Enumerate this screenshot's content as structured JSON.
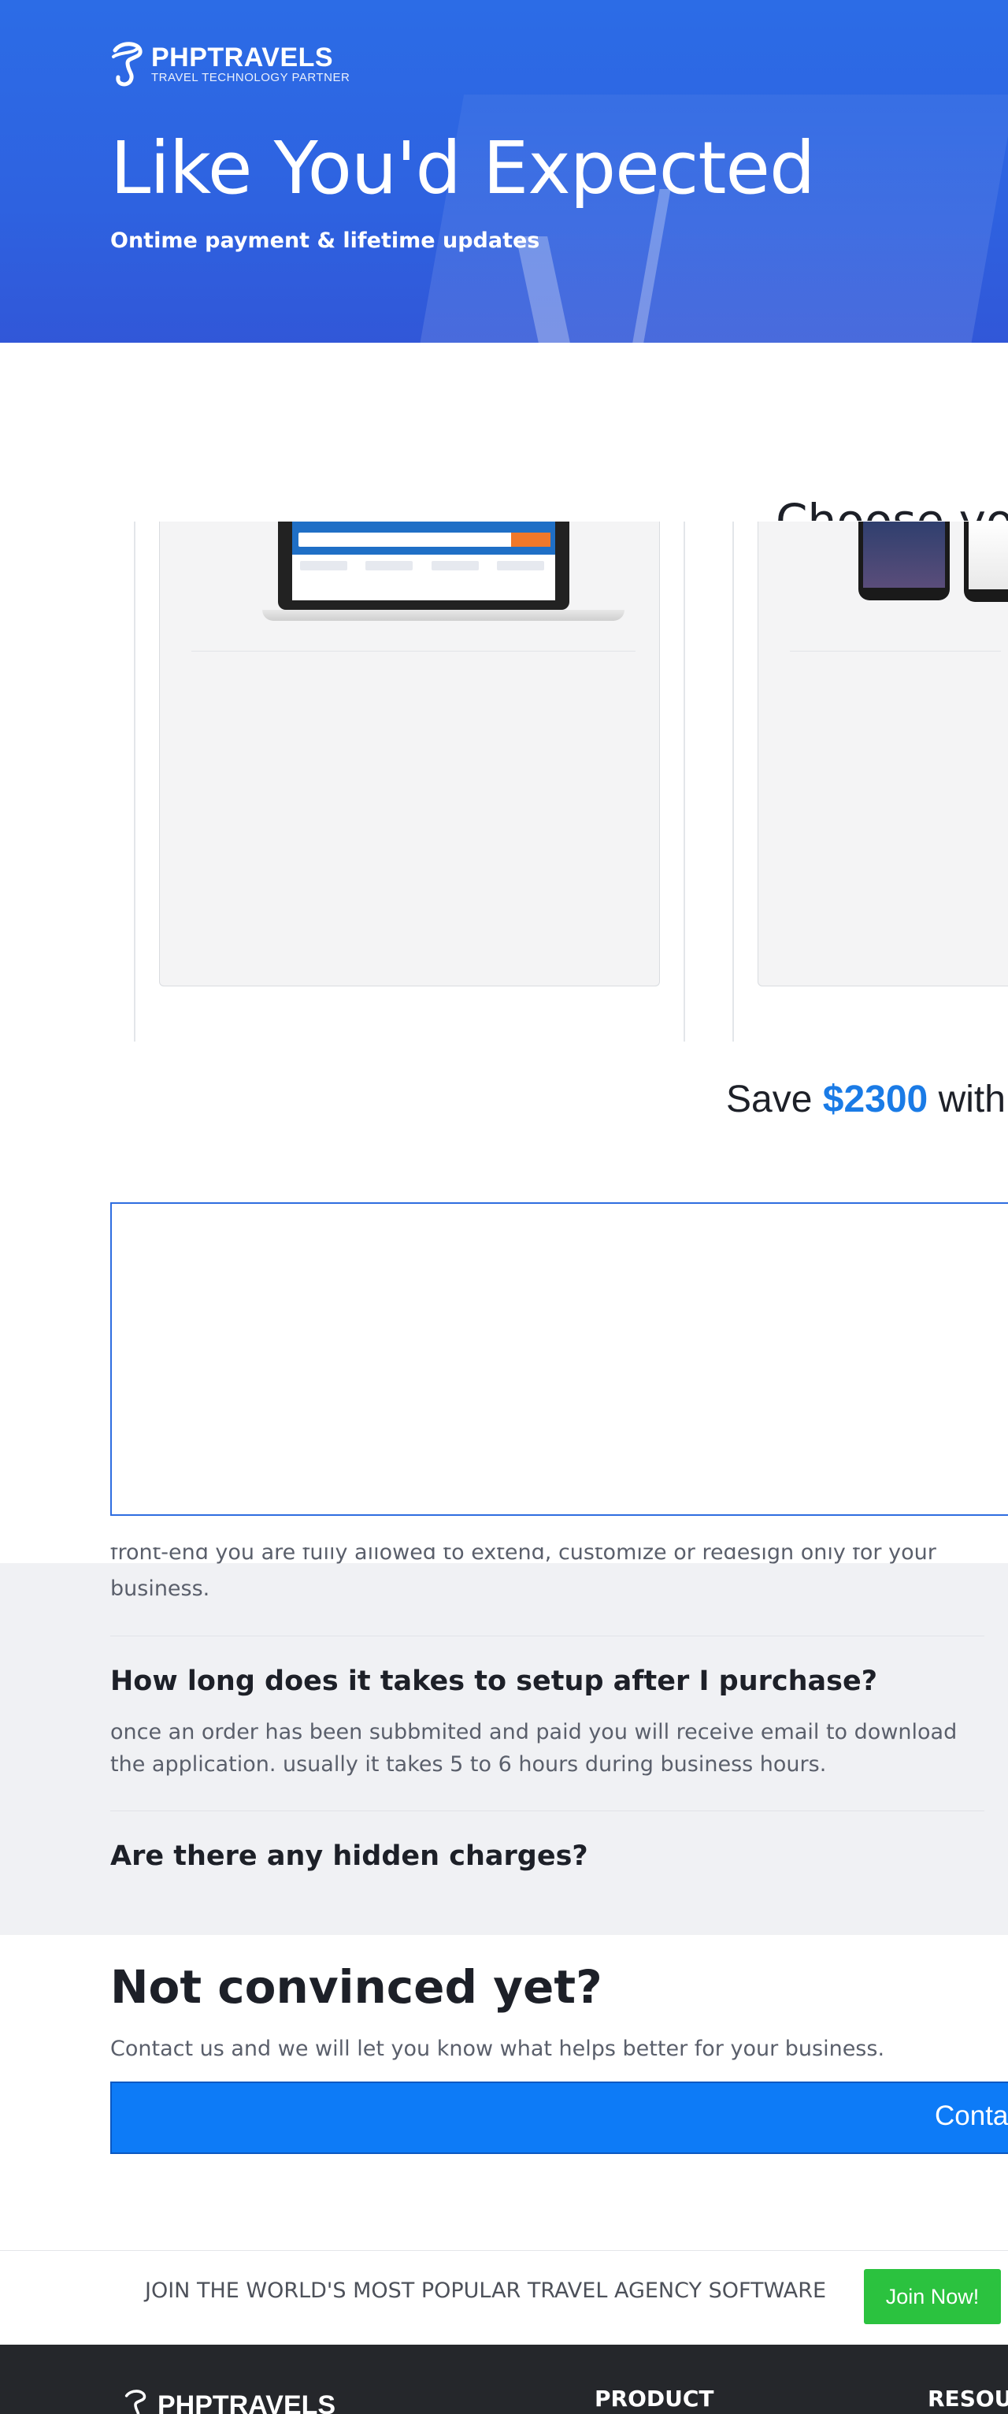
{
  "brand": {
    "name": "PHPTRAVELS",
    "tagline": "TRAVEL TECHNOLOGY PARTNER"
  },
  "hero": {
    "title": "Like You'd Expected",
    "subtitle": "Ontime payment & lifetime updates"
  },
  "pricing": {
    "heading": "Choose yo",
    "save_prefix": "Save ",
    "save_amount": "$2300",
    "save_suffix": " with"
  },
  "faq": {
    "partial_line": "front-end you are fully allowed to extend, customize or redesign only for your",
    "partial_line2": "business.",
    "items": [
      {
        "question": "How long does it takes to setup after I purchase?",
        "answer_line1": "once an order has been subbmited and paid you will receive email to download",
        "answer_line2": "the application. usually it takes 5 to 6 hours during business hours."
      },
      {
        "question": "Are there any hidden charges?"
      }
    ]
  },
  "convince": {
    "title": "Not convinced yet?",
    "subtitle": "Contact us and we will let you know what helps better for your business.",
    "button_label": "Conta"
  },
  "join": {
    "text": "JOIN THE WORLD'S MOST POPULAR TRAVEL AGENCY SOFTWARE",
    "button_label": "Join Now!"
  },
  "footer": {
    "brand": "PHPTRAVELS",
    "col_product": "PRODUCT",
    "col_resources": "RESOUR"
  },
  "colors": {
    "hero_blue": "#2e62e0",
    "accent_blue": "#1a7be6",
    "button_blue": "#0d7bf7",
    "join_green": "#2bc23f",
    "footer_dark": "#25272b"
  }
}
